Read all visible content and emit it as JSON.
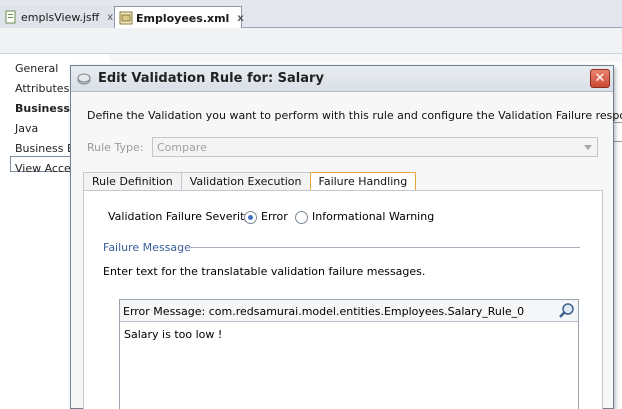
{
  "ide_tabs": [
    {
      "label": "emplsView.jsff",
      "close": "x"
    },
    {
      "label": "Employees.xml",
      "close": "x"
    }
  ],
  "left_nav": [
    "General",
    "Attributes",
    "Business",
    "Java",
    "Business Ev",
    "View Acces"
  ],
  "dialog": {
    "title": "Edit Validation Rule for: Salary",
    "close_symbol": "✕",
    "description": "Define the Validation you want to perform with this rule and configure the Validation Failure response.",
    "rule_type_label": "Rule Type:",
    "rule_type_value": "Compare",
    "tabs": [
      "Rule Definition",
      "Validation Execution",
      "Failure Handling"
    ],
    "active_tab": "Failure Handling",
    "severity_label": "Validation Failure Severity",
    "severity_options": [
      "Error",
      "Informational Warning"
    ],
    "severity_selected": "Error",
    "failure_message_title": "Failure Message",
    "enter_text": "Enter text for the translatable validation failure messages.",
    "error_message_header": "Error Message: com.redsamurai.model.entities.Employees.Salary_Rule_0",
    "error_message_text": "Salary is too low !"
  },
  "colors": {
    "active_tab_border": "#e8a540",
    "close_button": "#c84a34",
    "section_title": "#3a5f9a"
  },
  "icons": [
    "file-icon",
    "xml-file-icon",
    "dialog-title-icon",
    "close-icon",
    "dropdown-arrow-icon",
    "search-icon"
  ]
}
